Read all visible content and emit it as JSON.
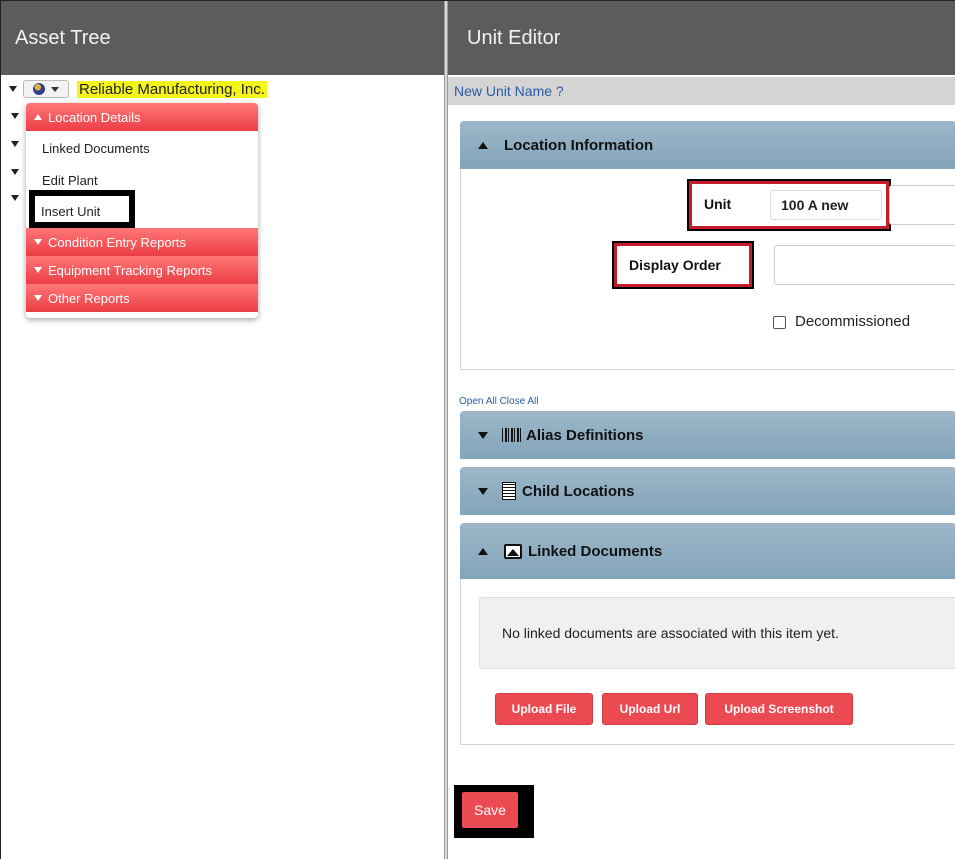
{
  "asset_tree": {
    "title": "Asset Tree",
    "root_label": "Reliable Manufacturing, Inc.",
    "menu": {
      "location_details": "Location Details",
      "linked_documents": "Linked Documents",
      "edit_plant": "Edit Plant",
      "insert_unit": "Insert Unit",
      "condition_entry_reports": "Condition Entry Reports",
      "equipment_tracking_reports": "Equipment Tracking Reports",
      "other_reports": "Other Reports"
    }
  },
  "unit_editor": {
    "title": "Unit Editor",
    "name_link": "New Unit Name ?",
    "location_information": {
      "header": "Location Information",
      "unit_label": "Unit",
      "unit_value": "100 A new",
      "display_order_label": "Display Order",
      "display_order_value": "",
      "decommissioned_label": "Decommissioned",
      "decommissioned_checked": false
    },
    "links": "Open All Close All",
    "alias_definitions": "Alias Definitions",
    "child_locations": "Child Locations",
    "linked_documents": {
      "header": "Linked Documents",
      "empty_message": "No linked documents are associated with this item yet.",
      "upload_file": "Upload File",
      "upload_url": "Upload Url",
      "upload_screenshot": "Upload Screenshot"
    },
    "save": "Save"
  },
  "colors": {
    "header_bg": "#5c5c5c",
    "menu_red": "#ec3e45",
    "section_header": "#8fadc1",
    "link_blue": "#2b5ba8",
    "highlight_yellow": "#f5f51a"
  }
}
